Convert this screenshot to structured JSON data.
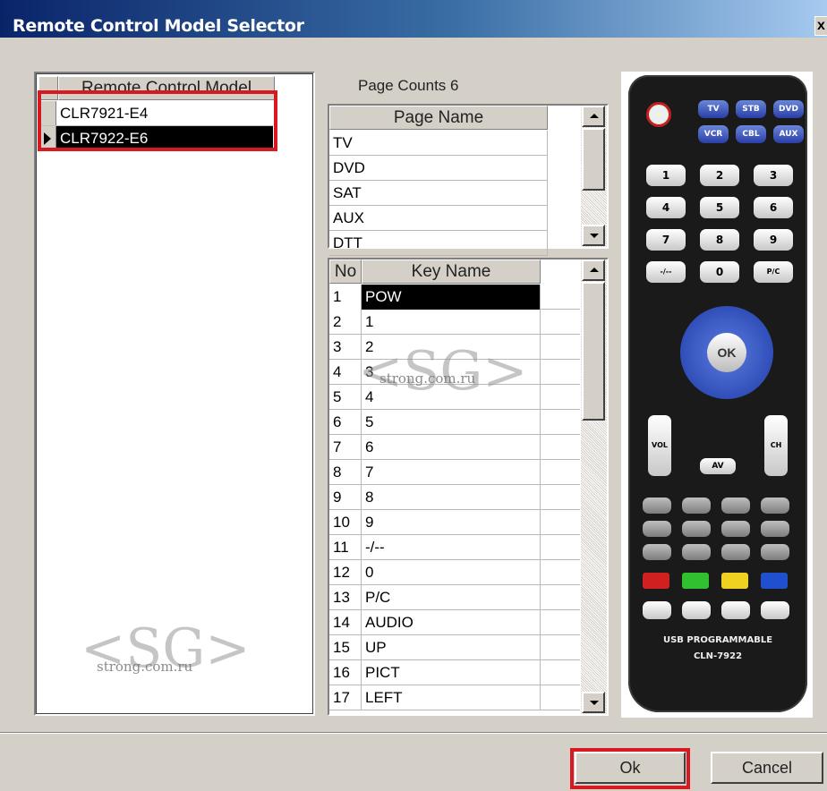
{
  "window": {
    "title": "Remote Control Model Selector",
    "close_glyph": "x"
  },
  "model_list": {
    "header": "Remote Control Model",
    "rows": [
      {
        "name": "CLR7921-E4",
        "selected": false
      },
      {
        "name": "CLR7922-E6",
        "selected": true
      }
    ]
  },
  "page_counts": "Page Counts 6",
  "pages": {
    "header": "Page Name",
    "rows": [
      "TV",
      "DVD",
      "SAT",
      "AUX",
      "DTT"
    ]
  },
  "keys": {
    "header_no": "No",
    "header_name": "Key Name",
    "rows": [
      {
        "no": "1",
        "name": "POW"
      },
      {
        "no": "2",
        "name": "1"
      },
      {
        "no": "3",
        "name": "2"
      },
      {
        "no": "4",
        "name": "3"
      },
      {
        "no": "5",
        "name": "4"
      },
      {
        "no": "6",
        "name": "5"
      },
      {
        "no": "7",
        "name": "6"
      },
      {
        "no": "8",
        "name": "7"
      },
      {
        "no": "9",
        "name": "8"
      },
      {
        "no": "10",
        "name": "9"
      },
      {
        "no": "11",
        "name": "-/--"
      },
      {
        "no": "12",
        "name": "0"
      },
      {
        "no": "13",
        "name": "P/C"
      },
      {
        "no": "14",
        "name": "AUDIO"
      },
      {
        "no": "15",
        "name": "UP"
      },
      {
        "no": "16",
        "name": "PICT"
      },
      {
        "no": "17",
        "name": "LEFT"
      }
    ]
  },
  "remote_image": {
    "caption_line1": "USB PROGRAMMABLE",
    "caption_line2": "CLN-7922",
    "top_keys": [
      "TV",
      "STB",
      "DVD",
      "VCR",
      "CBL",
      "AUX"
    ],
    "digits": [
      "1",
      "2",
      "3",
      "4",
      "5",
      "6",
      "7",
      "8",
      "9",
      "-/--",
      "0",
      "P/C"
    ],
    "ok": "OK",
    "vol": "VOL",
    "ch": "CH",
    "av": "AV"
  },
  "watermark": {
    "logo": "<SG>",
    "site": "strong.com.ru"
  },
  "buttons": {
    "ok": "Ok",
    "cancel": "Cancel"
  },
  "colors": {
    "highlight_red": "#d71920",
    "title_blue": "#0a246a"
  }
}
